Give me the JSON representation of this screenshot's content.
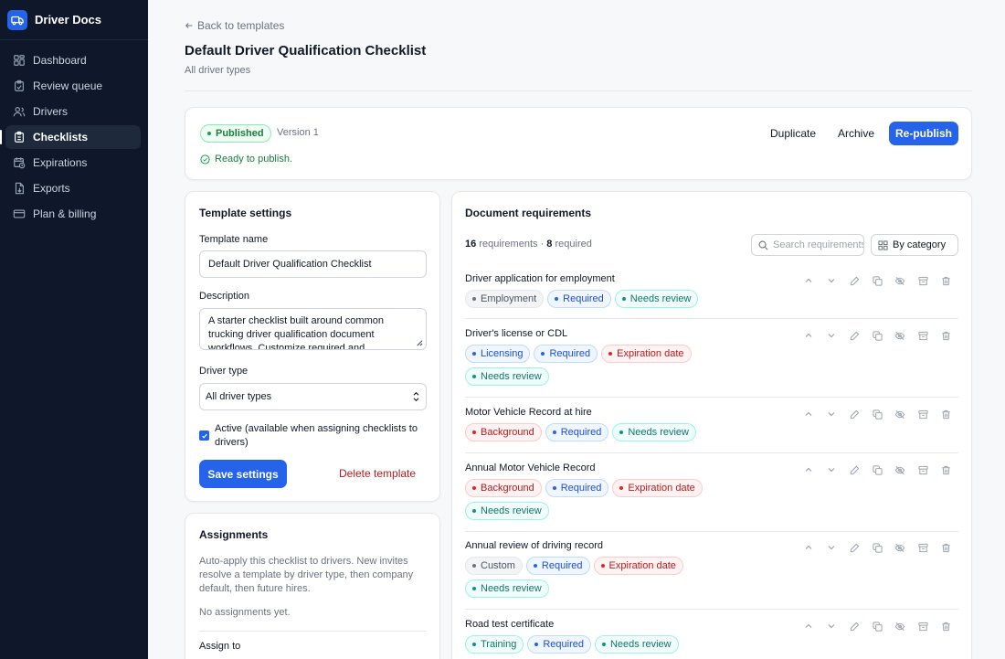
{
  "app": {
    "name": "Driver Docs"
  },
  "nav": [
    {
      "label": "Dashboard",
      "icon": "dashboard-icon"
    },
    {
      "label": "Review queue",
      "icon": "clipboard-check-icon"
    },
    {
      "label": "Drivers",
      "icon": "users-icon"
    },
    {
      "label": "Checklists",
      "icon": "clipboard-list-icon",
      "active": true
    },
    {
      "label": "Expirations",
      "icon": "calendar-clock-icon"
    },
    {
      "label": "Exports",
      "icon": "file-export-icon"
    },
    {
      "label": "Plan & billing",
      "icon": "credit-card-icon"
    }
  ],
  "header": {
    "back": "Back to templates",
    "title": "Default Driver Qualification Checklist",
    "subtitle": "All driver types"
  },
  "status": {
    "badge": "Published",
    "version": "Version 1",
    "ready": "Ready to publish.",
    "duplicate": "Duplicate",
    "archive": "Archive",
    "republish": "Re-publish"
  },
  "settings": {
    "title": "Template settings",
    "name_label": "Template name",
    "name_value": "Default Driver Qualification Checklist",
    "desc_label": "Description",
    "desc_value": "A starter checklist built around common trucking driver qualification document workflows. Customize required and",
    "type_label": "Driver type",
    "type_value": "All driver types",
    "active_label": "Active (available when assigning checklists to drivers)",
    "save": "Save settings",
    "delete": "Delete template"
  },
  "assignments": {
    "title": "Assignments",
    "description": "Auto-apply this checklist to drivers. New invites resolve a template by driver type, then company default, then future hires.",
    "empty": "No assignments yet.",
    "assign_to": "Assign to"
  },
  "requirements": {
    "title": "Document requirements",
    "count": "16",
    "count_suffix": "requirements · ",
    "required_count": "8",
    "required_suffix": "required",
    "search_placeholder": "Search requirements",
    "group_by": "By category",
    "items": [
      {
        "name": "Driver application for employment",
        "tags": [
          {
            "label": "Employment",
            "color": "gray"
          },
          {
            "label": "Required",
            "color": "blue"
          },
          {
            "label": "Needs review",
            "color": "teal"
          }
        ]
      },
      {
        "name": "Driver's license or CDL",
        "tags": [
          {
            "label": "Licensing",
            "color": "blue"
          },
          {
            "label": "Required",
            "color": "blue"
          },
          {
            "label": "Expiration date",
            "color": "red"
          },
          {
            "label": "Needs review",
            "color": "teal"
          }
        ]
      },
      {
        "name": "Motor Vehicle Record at hire",
        "tags": [
          {
            "label": "Background",
            "color": "red"
          },
          {
            "label": "Required",
            "color": "blue"
          },
          {
            "label": "Needs review",
            "color": "teal"
          }
        ]
      },
      {
        "name": "Annual Motor Vehicle Record",
        "tags": [
          {
            "label": "Background",
            "color": "red"
          },
          {
            "label": "Required",
            "color": "blue"
          },
          {
            "label": "Expiration date",
            "color": "red"
          },
          {
            "label": "Needs review",
            "color": "teal"
          }
        ]
      },
      {
        "name": "Annual review of driving record",
        "tags": [
          {
            "label": "Custom",
            "color": "gray"
          },
          {
            "label": "Required",
            "color": "blue"
          },
          {
            "label": "Expiration date",
            "color": "red"
          },
          {
            "label": "Needs review",
            "color": "teal"
          }
        ]
      },
      {
        "name": "Road test certificate",
        "tags": [
          {
            "label": "Training",
            "color": "teal"
          },
          {
            "label": "Required",
            "color": "blue"
          },
          {
            "label": "Needs review",
            "color": "teal"
          }
        ]
      }
    ]
  }
}
